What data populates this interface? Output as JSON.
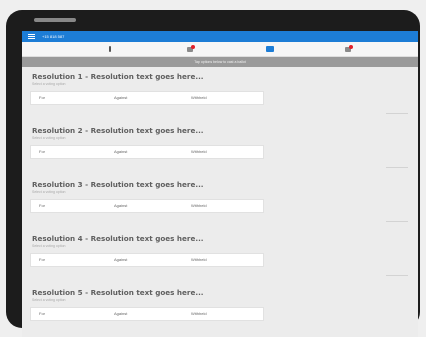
{
  "header": {
    "phone_number": "+15 818 587"
  },
  "notice": {
    "text": "Tap options below to cast a ballot"
  },
  "vote_options": {
    "for": "For",
    "against": "Against",
    "withheld": "Withheld"
  },
  "resolutions": [
    {
      "title": "Resolution 1 - Resolution text goes here...",
      "subtitle": "Select a voting option"
    },
    {
      "title": "Resolution 2 - Resolution text goes here...",
      "subtitle": "Select a voting option"
    },
    {
      "title": "Resolution 3 - Resolution text goes here...",
      "subtitle": "Select a voting option"
    },
    {
      "title": "Resolution 4 - Resolution text goes here...",
      "subtitle": "Select a voting option"
    },
    {
      "title": "Resolution 5 - Resolution text goes here...",
      "subtitle": "Select a voting option"
    }
  ],
  "colors": {
    "accent": "#1d7dd6",
    "alert": "#e0202a",
    "notice_bg": "#9a9a9a"
  }
}
